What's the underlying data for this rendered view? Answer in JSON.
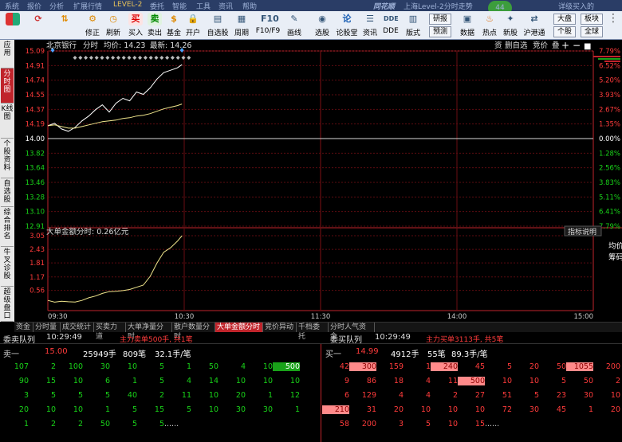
{
  "menu": {
    "items": [
      "系统",
      "报价",
      "分析",
      "扩展行情",
      "LEVEL-2",
      "委托",
      "智能",
      "工具",
      "资讯",
      "帮助"
    ],
    "brand": "同花顺",
    "window_title": "上海Level-2分时走势",
    "notice_count": "44",
    "promo": "详级买入的"
  },
  "toolbar": {
    "buttons": [
      "修正",
      "刷新",
      "买入",
      "卖出",
      "基金",
      "开户",
      "自选股",
      "周期",
      "F10/F9",
      "画线",
      "选股",
      "论股堂",
      "资讯",
      "DDE",
      "版式",
      "数据",
      "热点",
      "新股",
      "沪港通"
    ],
    "small_buttons": [
      "研报",
      "预测",
      "大盘",
      "板块",
      "个股",
      "全球"
    ]
  },
  "left_tabs": [
    "应用",
    "分时图",
    "K线图",
    "个股资料",
    "自选股",
    "综合排名",
    "牛叉诊股",
    "超级盘口"
  ],
  "chart": {
    "stock_name": "北京银行",
    "mode_label": "分时",
    "avg_label": "均价: 14.23",
    "last_label": "最新: 14.26",
    "right_tools": [
      "资",
      "删自选",
      "竞价",
      "叠"
    ],
    "prev_close": 14.0,
    "price_ticks": [
      "15.09",
      "14.91",
      "14.74",
      "14.55",
      "14.37",
      "14.19",
      "14.00",
      "13.82",
      "13.64",
      "13.46",
      "13.28",
      "13.10",
      "12.91"
    ],
    "pct_ticks": [
      "7.79%",
      "6.52%",
      "5.20%",
      "3.93%",
      "2.67%",
      "1.35%",
      "0.00%",
      "1.28%",
      "2.56%",
      "3.83%",
      "5.11%",
      "6.41%",
      "7.79%"
    ],
    "sub_title": "大单金额分时: 0.26亿元",
    "sub_button": "指标说明",
    "sub_ticks": [
      "3.05",
      "2.43",
      "1.81",
      "1.17",
      "0.56"
    ],
    "time_ticks": [
      "09:30",
      "10:30",
      "11:30",
      "14:00",
      "15:00"
    ],
    "right_side": [
      "均价",
      "筹码"
    ]
  },
  "chart_data": {
    "type": "line",
    "series": [
      {
        "name": "",
        "x": [
          "09:30",
          "09:33",
          "09:36",
          "09:39",
          "09:42",
          "09:45",
          "09:48",
          "09:51",
          "09:54",
          "09:57",
          "10:00",
          "10:03",
          "10:06",
          "10:09",
          "10:12",
          "10:15",
          "10:18",
          "10:21",
          "10:24",
          "10:27",
          "10:29"
        ],
        "values": [
          14.16,
          14.19,
          14.12,
          14.09,
          14.14,
          14.22,
          14.28,
          14.36,
          14.42,
          14.33,
          14.44,
          14.5,
          14.47,
          14.58,
          14.55,
          14.63,
          14.74,
          14.82,
          14.85,
          14.88,
          14.92
        ]
      },
      {
        "name": "均价",
        "values": [
          14.16,
          14.17,
          14.15,
          14.13,
          14.13,
          14.15,
          14.17,
          14.19,
          14.21,
          14.22,
          14.23,
          14.25,
          14.26,
          14.28,
          14.29,
          14.31,
          14.34,
          14.37,
          14.39,
          14.41,
          14.43
        ]
      },
      {
        "name": "大单金额分时",
        "values": [
          0.1,
          0.02,
          0.06,
          0.04,
          0.03,
          0.1,
          0.22,
          0.3,
          0.42,
          0.5,
          0.52,
          0.55,
          0.6,
          0.7,
          0.8,
          1.2,
          1.8,
          2.3,
          2.5,
          2.8,
          3.05
        ]
      }
    ],
    "ylim": [
      12.91,
      15.09
    ],
    "sub_ylim": [
      0,
      3.05
    ]
  },
  "bottom_tabs": [
    "资金",
    "分时量",
    "成交统计",
    "买卖力道",
    "大单净量分时",
    "散户数量分时",
    "大单金额分时",
    "竞价异动",
    "千档委托",
    "分时人气资金"
  ],
  "queue": {
    "sell_title": "委卖队列",
    "sell_time": "10:29:49",
    "sell_note": "主力卖单500手, 共1笔",
    "buy_title": "委买队列",
    "buy_time": "10:29:49",
    "buy_note": "主力买单3113手, 共5笔",
    "sell_head": {
      "label": "卖一",
      "price": "15.00",
      "vol": "25949手",
      "count": "809笔",
      "avg": "32.1手/笔"
    },
    "buy_head": {
      "label": "买一",
      "price": "14.99",
      "vol": "4912手",
      "count": "55笔",
      "avg": "89.3手/笔"
    },
    "sell_rows": [
      [
        "107",
        "2",
        "100",
        "30",
        "10",
        "5",
        "1",
        "50",
        "4",
        "10",
        "500"
      ],
      [
        "90",
        "15",
        "10",
        "6",
        "1",
        "5",
        "4",
        "14",
        "10",
        "10",
        "10"
      ],
      [
        "3",
        "5",
        "5",
        "5",
        "40",
        "2",
        "11",
        "10",
        "20",
        "1",
        "12"
      ],
      [
        "20",
        "10",
        "10",
        "1",
        "5",
        "15",
        "5",
        "10",
        "30",
        "30",
        "1"
      ],
      [
        "1",
        "2",
        "2",
        "50",
        "5",
        "5",
        "......",
        "",
        "",
        "",
        ""
      ]
    ],
    "buy_rows": [
      [
        "42",
        "300",
        "159",
        "1",
        "240",
        "45",
        "5",
        "20",
        "50",
        "1055",
        "200"
      ],
      [
        "9",
        "86",
        "18",
        "4",
        "11",
        "500",
        "10",
        "10",
        "5",
        "50",
        "2"
      ],
      [
        "6",
        "129",
        "4",
        "4",
        "2",
        "27",
        "51",
        "5",
        "23",
        "30",
        "10"
      ],
      [
        "210",
        "31",
        "20",
        "10",
        "10",
        "10",
        "72",
        "30",
        "45",
        "1",
        "20"
      ],
      [
        "58",
        "200",
        "3",
        "5",
        "10",
        "15",
        "......",
        "",
        "",
        "",
        ""
      ]
    ]
  }
}
